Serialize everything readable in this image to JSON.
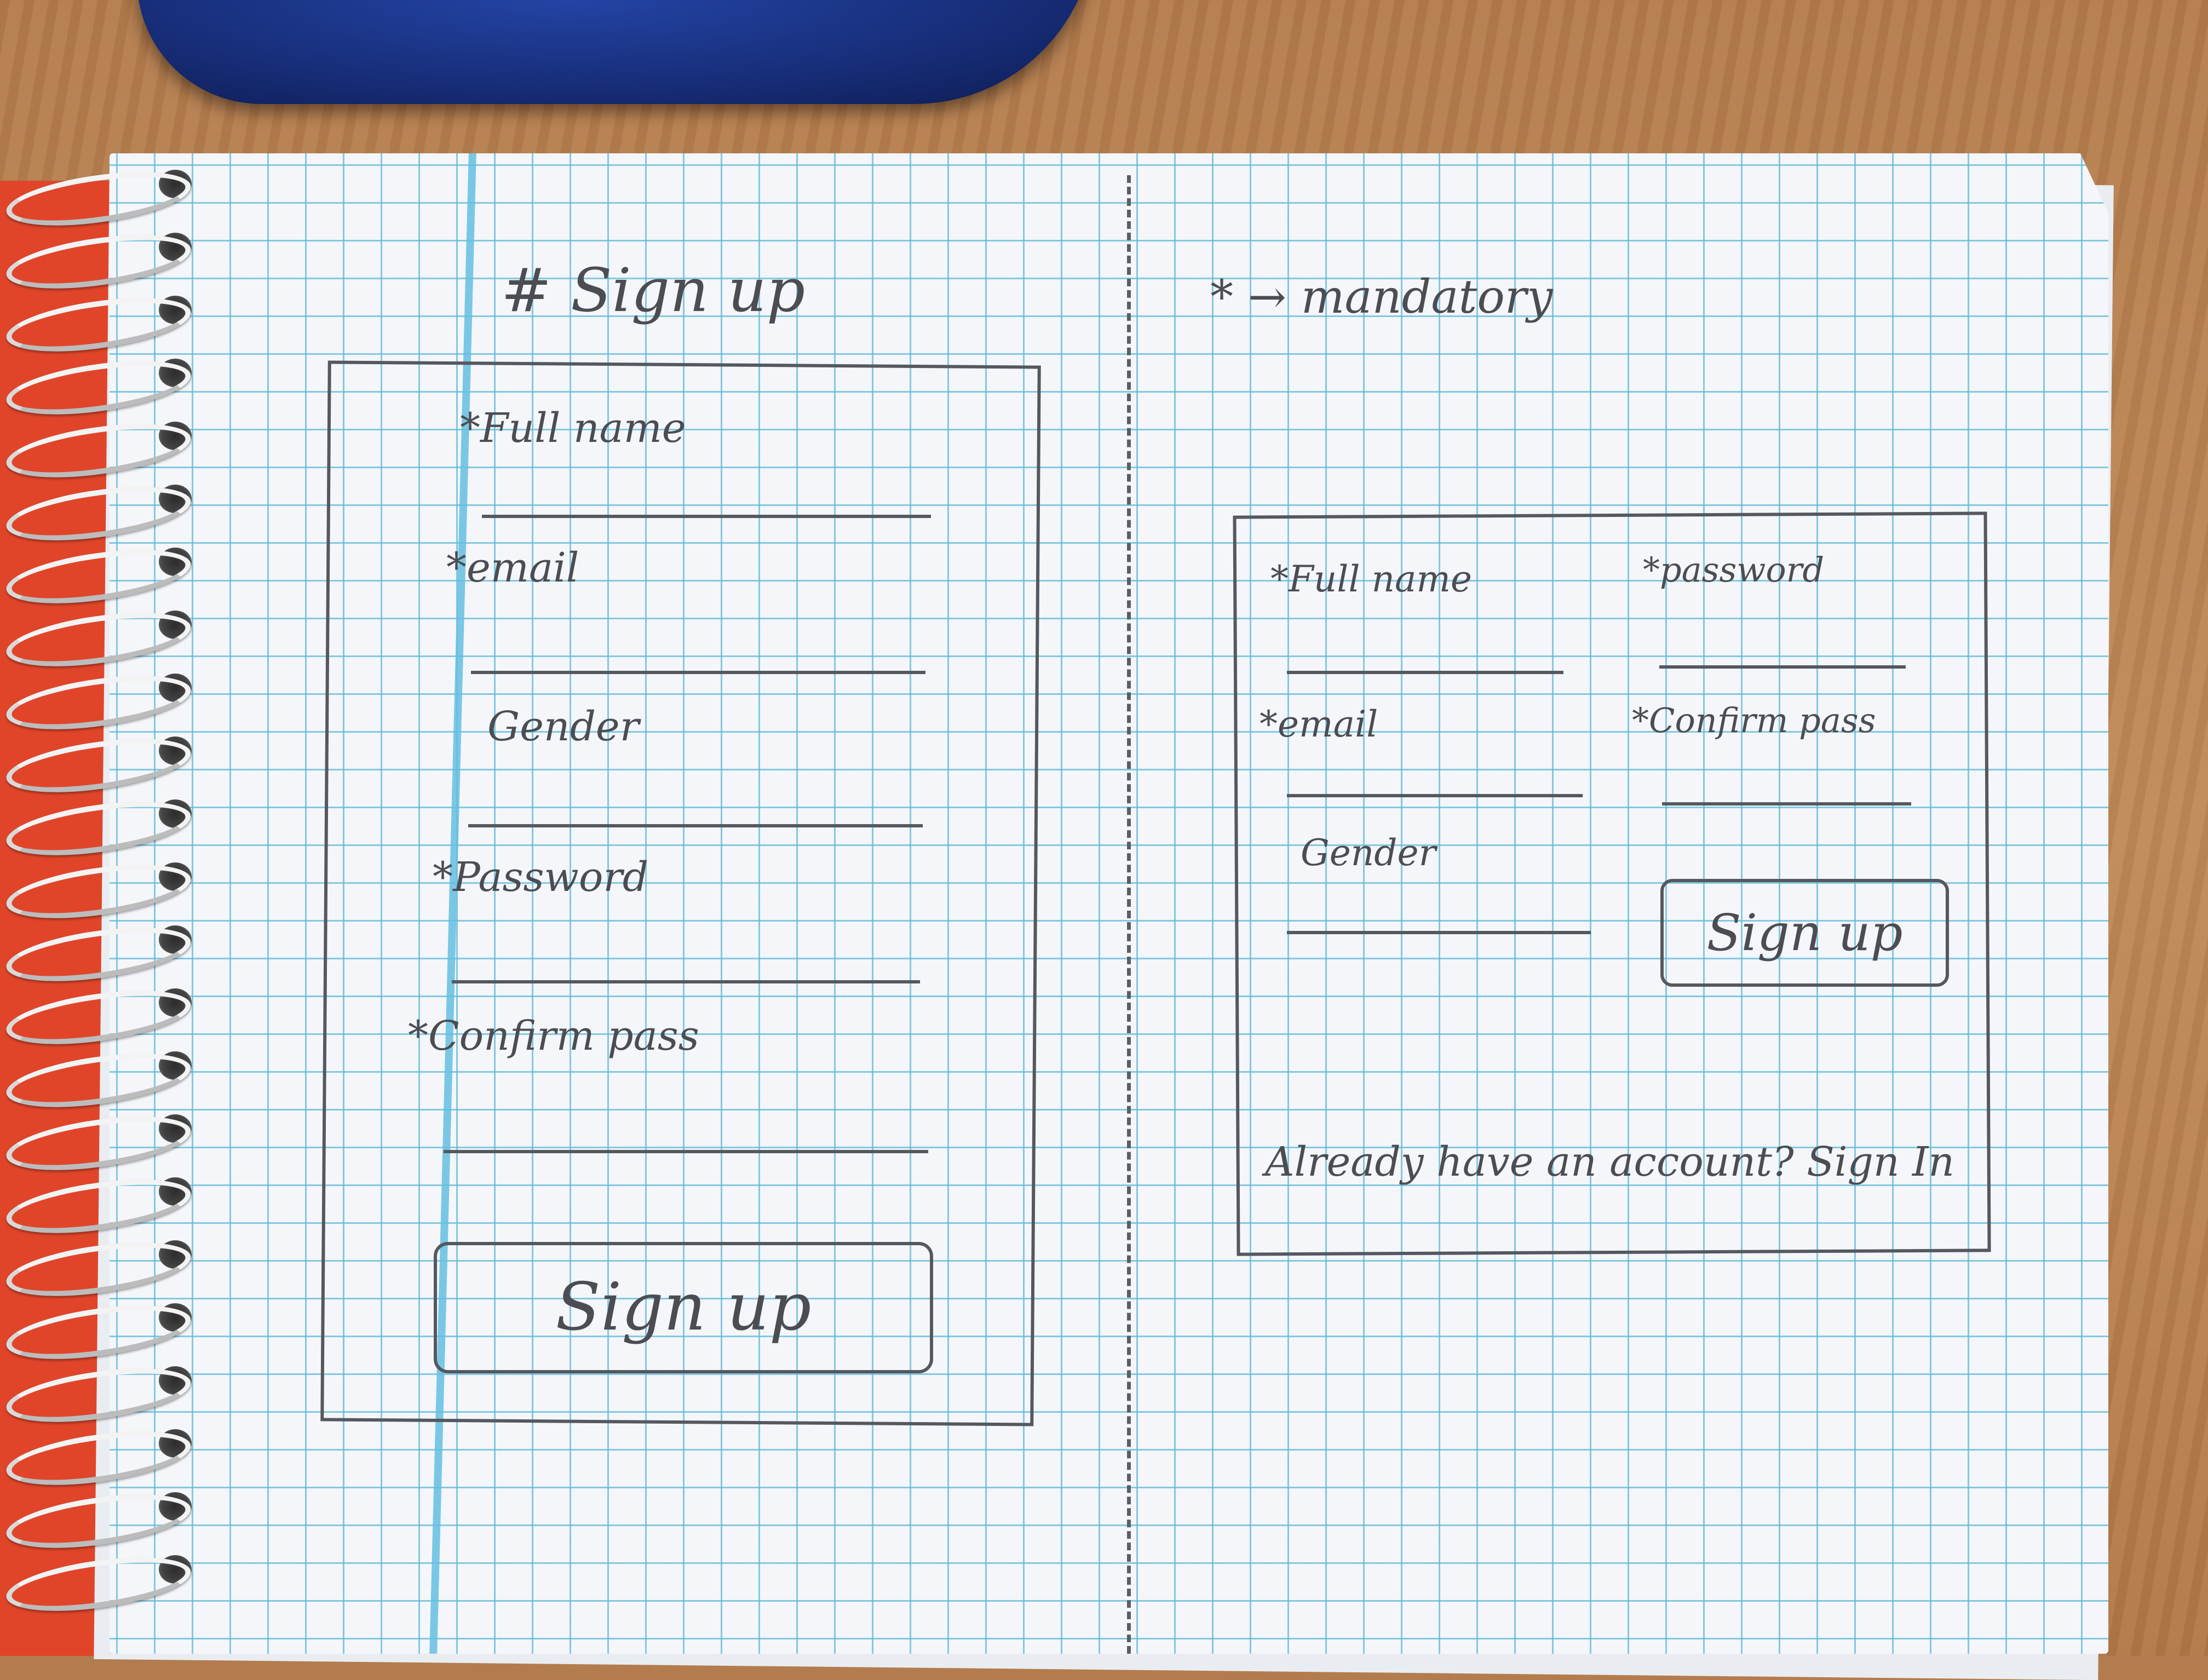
{
  "heading": "# Sign up",
  "legend_note": "* → mandatory",
  "mobile_form": {
    "fields": [
      {
        "label": "*Full name"
      },
      {
        "label": "*email"
      },
      {
        "label": "Gender"
      },
      {
        "label": "*Password"
      },
      {
        "label": "*Confirm pass"
      }
    ],
    "submit_label": "Sign up"
  },
  "desktop_form": {
    "left_fields": [
      {
        "label": "*Full name"
      },
      {
        "label": "*email"
      },
      {
        "label": "Gender"
      }
    ],
    "right_fields": [
      {
        "label": "*password"
      },
      {
        "label": "*Confirm pass"
      }
    ],
    "submit_label": "Sign up",
    "signin_prompt": "Already have an account? Sign In"
  },
  "colors": {
    "pencil": "#55585d",
    "grid": "#5fb9d7",
    "desk": "#b98250",
    "pouch": "#1a2f7a",
    "notebook_edge": "#e0452a"
  }
}
